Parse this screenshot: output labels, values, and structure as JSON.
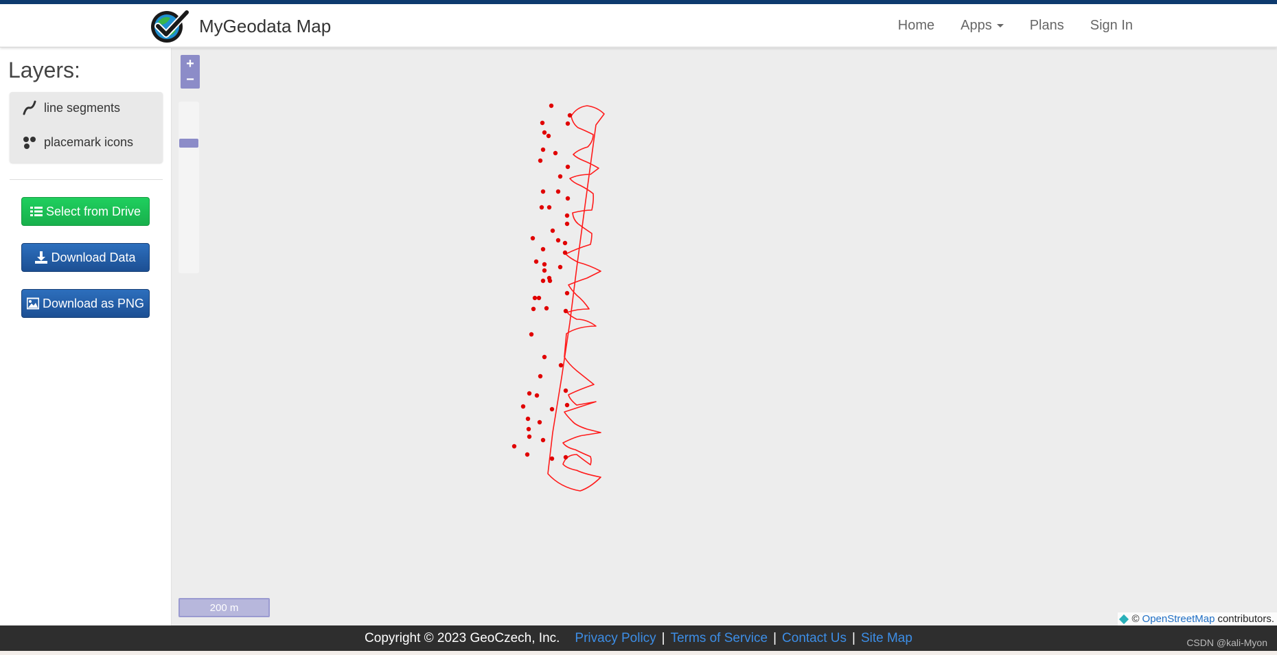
{
  "brand": {
    "title": "MyGeodata Map"
  },
  "nav": {
    "items": [
      {
        "label": "Home"
      },
      {
        "label": "Apps"
      },
      {
        "label": "Plans"
      },
      {
        "label": "Sign In"
      }
    ]
  },
  "sidebar": {
    "layers_title": "Layers:",
    "layers": [
      {
        "label": "line segments",
        "icon": "line-segments-icon"
      },
      {
        "label": "placemark icons",
        "icon": "placemark-icons-icon"
      }
    ],
    "buttons": {
      "select_drive": "Select from Drive",
      "download_data": "Download Data",
      "download_png": "Download as PNG"
    }
  },
  "map": {
    "zoom_in": "+",
    "zoom_out": "−",
    "scale_label": "200 m",
    "attribution": {
      "prefix": "©",
      "link": "OpenStreetMap",
      "suffix": "contributors."
    },
    "track_color": "#ff1a1a"
  },
  "footer": {
    "copyright": "Copyright © 2023 GeoCzech, Inc.",
    "links": [
      "Privacy Policy",
      "Terms of Service",
      "Contact Us",
      "Site Map"
    ]
  },
  "watermark": "CSDN @kali-Myon",
  "colors": {
    "header_strip": "#0d3a6e",
    "button_green": "#1fcf5e",
    "button_blue": "#1c4f93",
    "zoom_control": "#8c8cc8",
    "footer_bg": "#2e2e2e",
    "link": "#3d8ee6"
  }
}
